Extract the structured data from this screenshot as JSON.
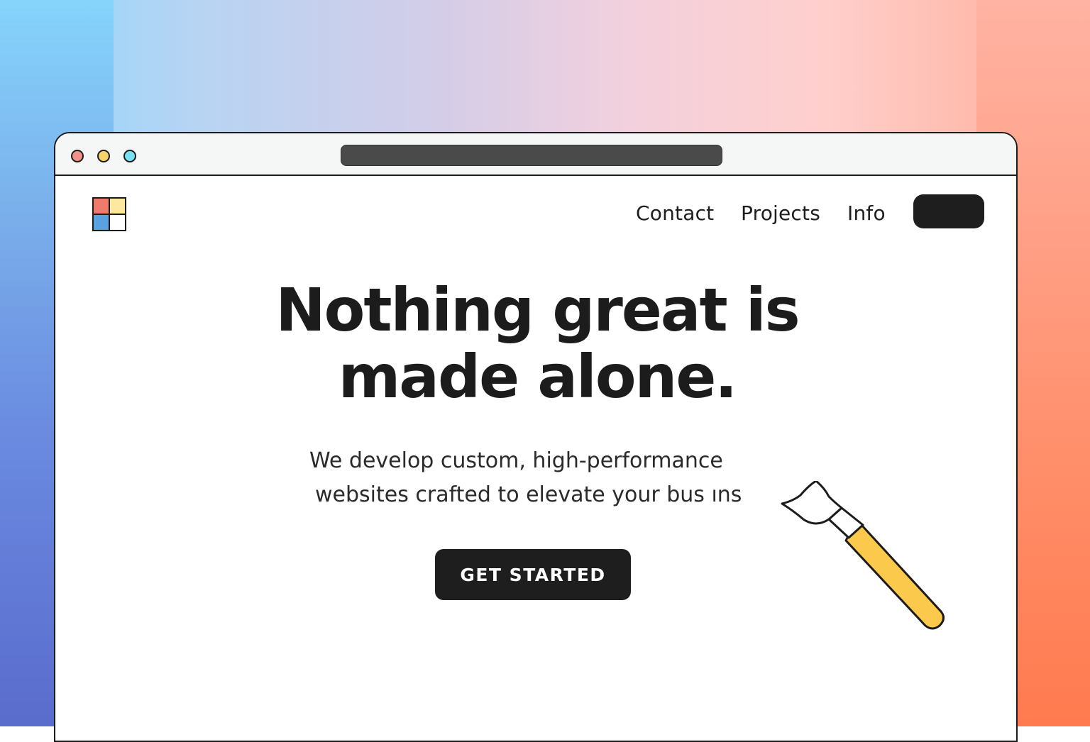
{
  "colors": {
    "accent_dark": "#1e1e1e",
    "logo_red": "#f07b6b",
    "logo_yellow": "#fde8a0",
    "logo_blue": "#5aa1e0",
    "brush_handle": "#fbc94c",
    "dot_red": "#f19189",
    "dot_yellow": "#f7d16a",
    "dot_cyan": "#79e0ef"
  },
  "header": {
    "logo_icon": "four-square-logo",
    "nav": [
      {
        "label": "Contact"
      },
      {
        "label": "Projects"
      },
      {
        "label": "Info"
      }
    ],
    "nav_button_label": ""
  },
  "hero": {
    "headline_line1": "Nothing great is",
    "headline_line2": "made alone.",
    "subtext_line1": "We develop custom, high-performance",
    "subtext_line2": "websites crafted to elevate your bus ıns",
    "cta_label": "GET STARTED"
  },
  "illustration": {
    "icon": "paintbrush-icon"
  }
}
